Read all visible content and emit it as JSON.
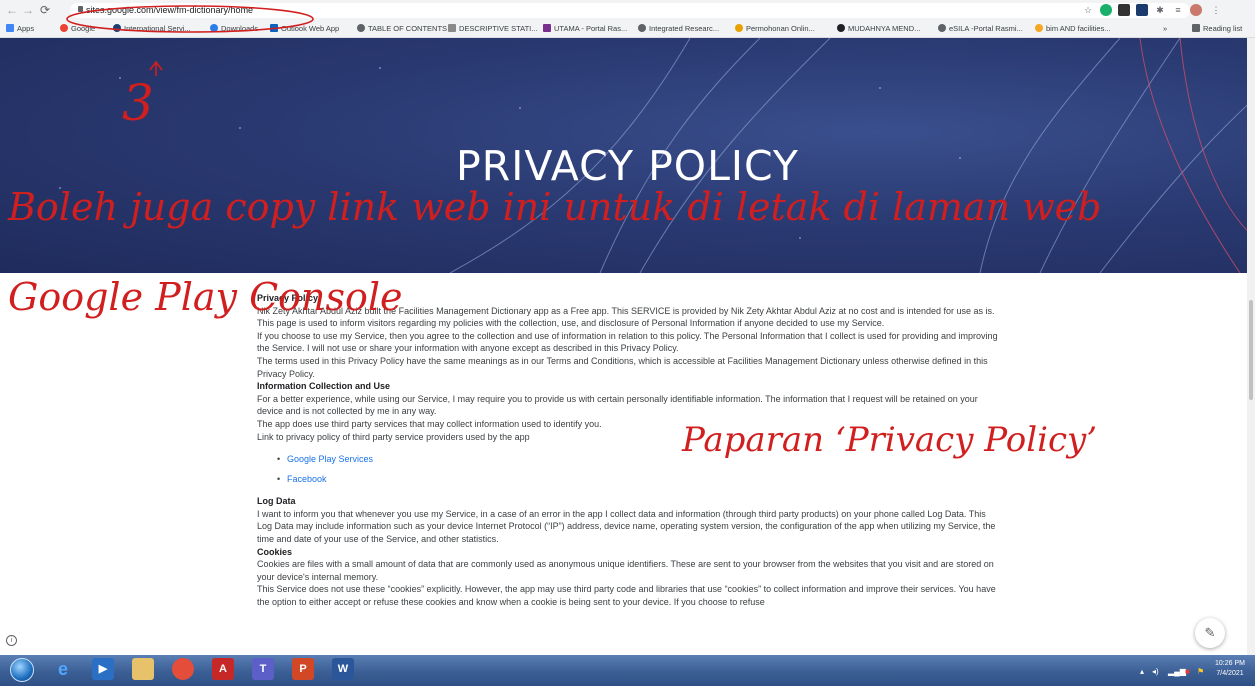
{
  "browser": {
    "url": "sites.google.com/view/fm-dictionary/home",
    "bookmarks": [
      "Apps",
      "Google",
      "International Servi...",
      "Downloads",
      "Outlook Web App",
      "TABLE OF CONTENTS",
      "DESCRIPTIVE STATI...",
      "UTAMA - Portal Ras...",
      "Integrated Researc...",
      "Permohonan Onlin...",
      "MUDAHNYA MEND...",
      "eSILA -Portal Rasmi...",
      "bim AND facilities...",
      "»",
      "Reading list"
    ]
  },
  "banner": {
    "title": "PRIVACY POLICY"
  },
  "policy": {
    "heading": "Privacy Policy",
    "intro": [
      "Nik Zety Akhtar Abdul Aziz built the Facilities Management Dictionary app as a Free app. This SERVICE is provided by Nik Zety Akhtar Abdul Aziz at no cost and is intended for use as is.",
      "This page is used to inform visitors regarding my policies with the collection, use, and disclosure of Personal Information if anyone decided to use my Service.",
      "If you choose to use my Service, then you agree to the collection and use of information in relation to this policy. The Personal Information that I collect is used for providing and improving the Service. I will not use or share your information with anyone except as described in this Privacy Policy.",
      "The terms used in this Privacy Policy have the same meanings as in our Terms and Conditions, which is accessible at Facilities Management Dictionary unless otherwise defined in this Privacy Policy."
    ],
    "info_heading": "Information Collection and Use",
    "info": [
      "For a better experience, while using our Service, I may require you to provide us with certain personally identifiable information. The information that I request will be retained on your device and is not collected by me in any way.",
      "The app does use third party services that may collect information used to identify you.",
      "Link to privacy policy of third party service providers used by the app"
    ],
    "links": [
      "Google Play Services",
      "Facebook"
    ],
    "log_heading": "Log Data",
    "log_text": "I want to inform you that whenever you use my Service, in a case of an error in the app I collect data and information (through third party products) on your phone called Log Data. This Log Data may include information such as your device Internet Protocol (“IP”) address, device name, operating system version, the configuration of the app when utilizing my Service, the time and date of your use of the Service, and other statistics.",
    "cookies_heading": "Cookies",
    "cookies": [
      "Cookies are files with a small amount of data that are commonly used as anonymous unique identifiers. These are sent to your browser from the websites that you visit and are stored on your device's internal memory.",
      "This Service does not use these “cookies” explicitly. However, the app may use third party code and libraries that use “cookies” to collect information and improve their services. You have the option to either accept or refuse these cookies and know when a cookie is being sent to your device. If you choose to refuse"
    ]
  },
  "annotations": {
    "number": "3",
    "line1": "Boleh juga copy link web ini untuk di letak di laman web",
    "line2": "Google Play Console",
    "note": "Paparan ‘Privacy Policy’"
  },
  "taskbar": {
    "time": "10:26 PM",
    "date": "7/4/2021"
  },
  "colors": {
    "annotation": "#d11f1f",
    "banner": "#2a3a72",
    "link": "#1a73e8"
  }
}
